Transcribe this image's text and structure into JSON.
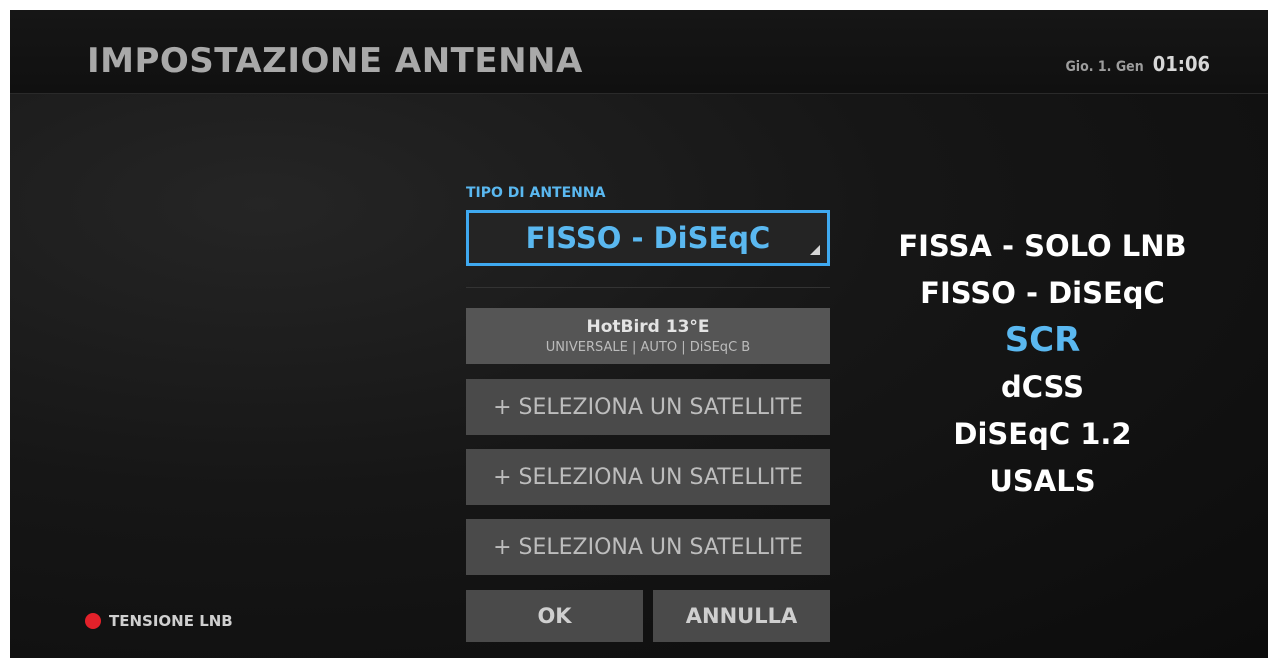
{
  "header": {
    "title": "IMPOSTAZIONE ANTENNA",
    "date": "Gio. 1. Gen",
    "time": "01:06"
  },
  "antenna": {
    "label": "TIPO DI ANTENNA",
    "selected": "FISSO - DiSEqC"
  },
  "satellites": [
    {
      "name": "HotBird 13°E",
      "detail": "UNIVERSALE | AUTO | DiSEqC B"
    },
    {
      "add_label": "+ SELEZIONA UN SATELLITE"
    },
    {
      "add_label": "+ SELEZIONA UN SATELLITE"
    },
    {
      "add_label": "+ SELEZIONA UN SATELLITE"
    }
  ],
  "buttons": {
    "ok": "OK",
    "cancel": "ANNULLA"
  },
  "antenna_options": [
    "FISSA - SOLO LNB",
    "FISSO - DiSEqC",
    "SCR",
    "dCSS",
    "DiSEqC 1.2",
    "USALS"
  ],
  "lnb_status": {
    "label": "TENSIONE LNB",
    "color": "#e3212a"
  },
  "colors": {
    "accent": "#3fa9f0"
  }
}
